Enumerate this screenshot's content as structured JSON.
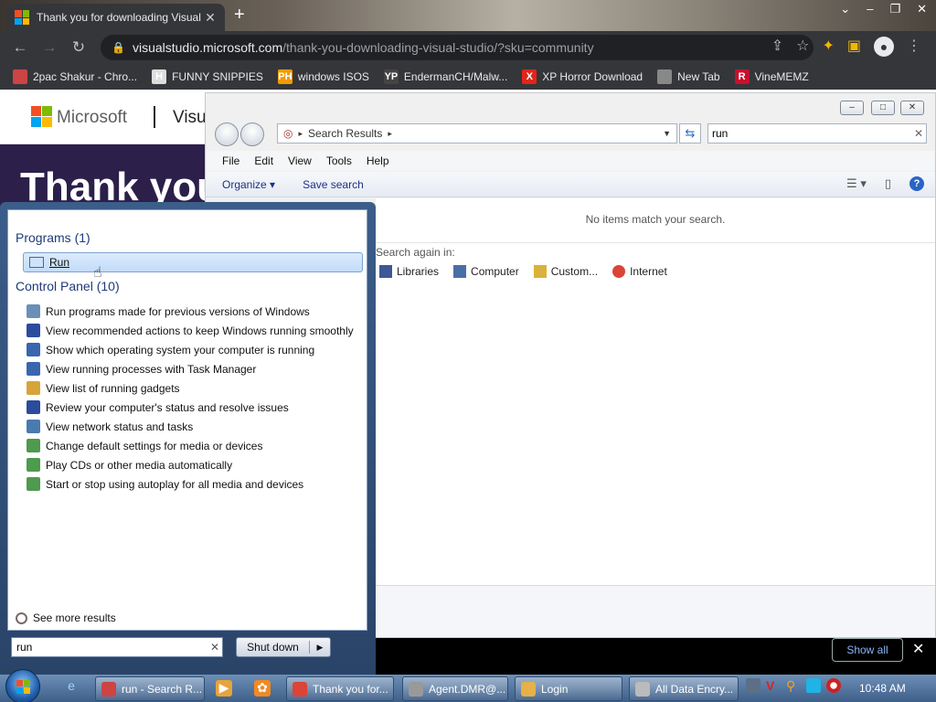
{
  "browser": {
    "tab_title": "Thank you for downloading Visual",
    "url_host": "visualstudio.microsoft.com",
    "url_path": "/thank-you-downloading-visual-studio/?sku=community",
    "bookmarks": [
      {
        "label": "2pac Shakur - Chro...",
        "icon_text": "",
        "color": "#c44"
      },
      {
        "label": "FUNNY SNIPPIES",
        "icon_text": "H",
        "color": "#ddd"
      },
      {
        "label": "windows ISOS",
        "icon_text": "PH",
        "color": "#f29a00"
      },
      {
        "label": "EndermanCH/Malw...",
        "icon_text": "YP",
        "color": "#444"
      },
      {
        "label": "XP Horror Download",
        "icon_text": "X",
        "color": "#e0261b"
      },
      {
        "label": "New Tab",
        "icon_text": "",
        "color": "#888"
      },
      {
        "label": "VineMEMZ",
        "icon_text": "R",
        "color": "#c8102e"
      }
    ]
  },
  "page": {
    "brand": "Microsoft",
    "product": "Visu",
    "hero_title": "Thank you"
  },
  "explorer": {
    "breadcrumb": "Search Results",
    "search_value": "run",
    "menu": [
      "File",
      "Edit",
      "View",
      "Tools",
      "Help"
    ],
    "commands": {
      "organize": "Organize",
      "save_search": "Save search"
    },
    "no_items": "No items match your search.",
    "search_again_label": "Search again in:",
    "search_again": [
      {
        "label": "Libraries",
        "color": "#3b5998"
      },
      {
        "label": "Computer",
        "color": "#4a6fa5"
      },
      {
        "label": "Custom...",
        "color": "#d8b23a"
      },
      {
        "label": "Internet",
        "color": "#db4437"
      }
    ]
  },
  "start_menu": {
    "programs_header": "Programs (1)",
    "run_label": "Run",
    "control_panel_header": "Control Panel (10)",
    "control_panel_items": [
      {
        "label": "Run programs made for previous versions of Windows",
        "color": "#6b8fb8"
      },
      {
        "label": "View recommended actions to keep Windows running smoothly",
        "color": "#2b4c9c"
      },
      {
        "label": "Show which operating system your computer is running",
        "color": "#3a66b0"
      },
      {
        "label": "View running processes with Task Manager",
        "color": "#3a66b0"
      },
      {
        "label": "View list of running gadgets",
        "color": "#d7a43a"
      },
      {
        "label": "Review your computer's status and resolve issues",
        "color": "#2b4c9c"
      },
      {
        "label": "View network status and tasks",
        "color": "#4a7bb0"
      },
      {
        "label": "Change default settings for media or devices",
        "color": "#4e9a4e"
      },
      {
        "label": "Play CDs or other media automatically",
        "color": "#4e9a4e"
      },
      {
        "label": "Start or stop using autoplay for all media and devices",
        "color": "#4e9a4e"
      }
    ],
    "see_more": "See more results",
    "search_value": "run",
    "shutdown_label": "Shut down"
  },
  "downloads": {
    "show_all": "Show all"
  },
  "taskbar": {
    "items": [
      {
        "label": "run - Search R...",
        "color": "#c44"
      },
      {
        "label": "Thank you for...",
        "color": "#db4437"
      },
      {
        "label": "Agent.DMR@...",
        "color": "#999"
      },
      {
        "label": "Login",
        "color": "#e6b04a"
      },
      {
        "label": "All Data Encry...",
        "color": "#bbb"
      }
    ],
    "clock": "10:48 AM"
  }
}
